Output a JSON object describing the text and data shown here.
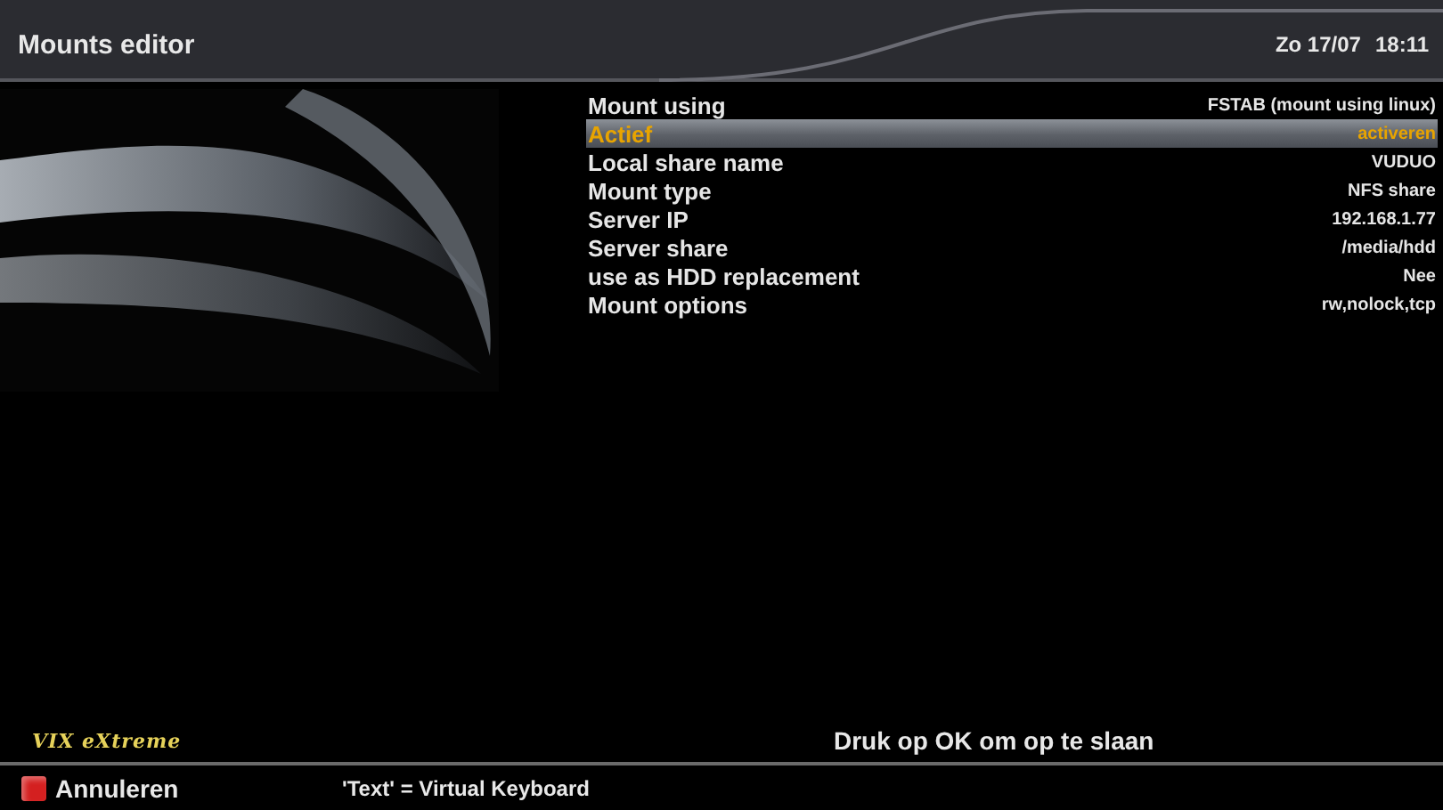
{
  "header": {
    "title": "Mounts editor",
    "date": "Zo 17/07",
    "time": "18:11"
  },
  "settings": [
    {
      "label": "Mount using",
      "value": "FSTAB (mount using linux)",
      "selected": false
    },
    {
      "label": "Actief",
      "value": "activeren",
      "selected": true
    },
    {
      "label": "Local share name",
      "value": "VUDUO",
      "selected": false
    },
    {
      "label": "Mount type",
      "value": "NFS share",
      "selected": false
    },
    {
      "label": "Server IP",
      "value": "192.168.1.77",
      "selected": false
    },
    {
      "label": "Server share",
      "value": "/media/hdd",
      "selected": false
    },
    {
      "label": "use as HDD replacement",
      "value": "Nee",
      "selected": false
    },
    {
      "label": "Mount options",
      "value": "rw,nolock,tcp",
      "selected": false
    }
  ],
  "brand": "VIX eXtreme",
  "status": "Druk op OK om op te slaan",
  "buttons": [
    {
      "label": "Annuleren",
      "color": "#d42020"
    }
  ],
  "hint": "'Text' = Virtual Keyboard"
}
